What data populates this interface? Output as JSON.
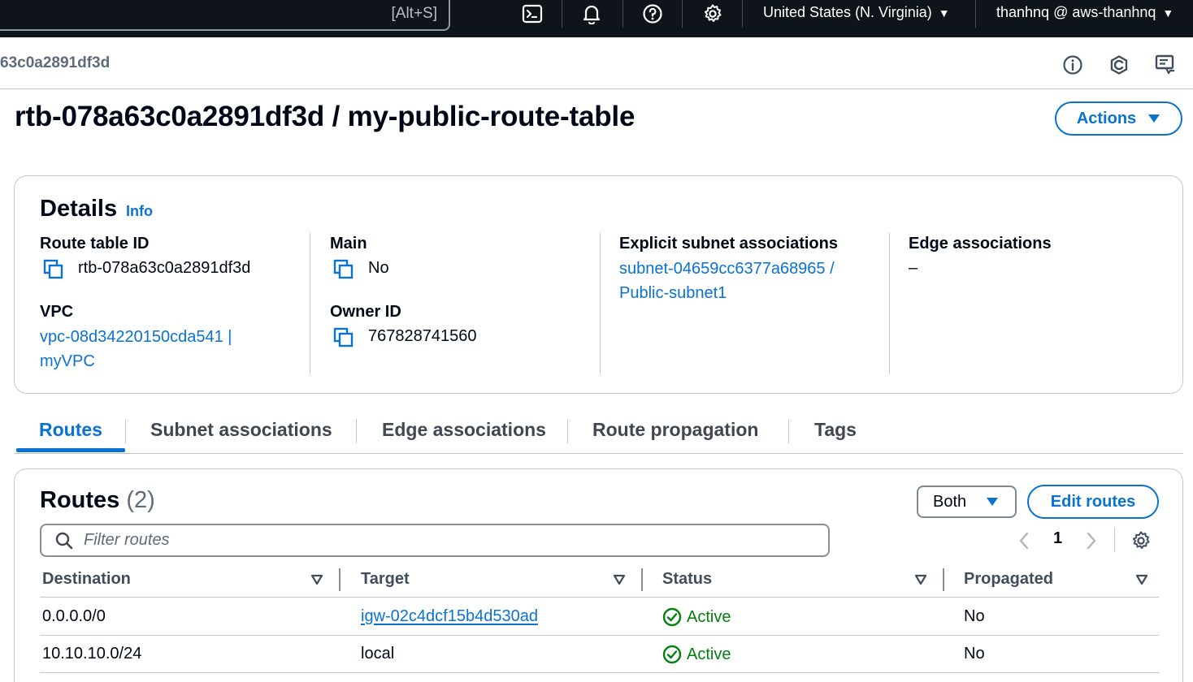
{
  "topnav": {
    "search_hint": "[Alt+S]",
    "region": "United States (N. Virginia)",
    "account": "thanhnq @ aws-thanhnq"
  },
  "breadcrumb": {
    "current": "63c0a2891df3d"
  },
  "page": {
    "title": "rtb-078a63c0a2891df3d / my-public-route-table",
    "actions_label": "Actions"
  },
  "details": {
    "title": "Details",
    "info": "Info",
    "route_table_id_label": "Route table ID",
    "route_table_id": "rtb-078a63c0a2891df3d",
    "main_label": "Main",
    "main": "No",
    "explicit_label": "Explicit subnet associations",
    "explicit_line1": "subnet-04659cc6377a68965 /",
    "explicit_line2": "Public-subnet1",
    "edge_label": "Edge associations",
    "edge": "–",
    "vpc_label": "VPC",
    "vpc_line1": "vpc-08d34220150cda541 |",
    "vpc_line2": "myVPC",
    "owner_label": "Owner ID",
    "owner": "767828741560"
  },
  "tabs": [
    "Routes",
    "Subnet associations",
    "Edge associations",
    "Route propagation",
    "Tags"
  ],
  "routes": {
    "title": "Routes",
    "count": "(2)",
    "filter_select": "Both",
    "edit_label": "Edit routes",
    "filter_placeholder": "Filter routes",
    "page": "1",
    "columns": [
      "Destination",
      "Target",
      "Status",
      "Propagated"
    ],
    "rows": [
      {
        "destination": "0.0.0.0/0",
        "target": "igw-02c4dcf15b4d530ad",
        "status": "Active",
        "propagated": "No"
      },
      {
        "destination": "10.10.10.0/24",
        "target": "local",
        "status": "Active",
        "propagated": "No"
      }
    ]
  },
  "colors": {
    "accent": "#0972d3",
    "nav_bg": "#0f141a",
    "success": "#037f0c"
  }
}
